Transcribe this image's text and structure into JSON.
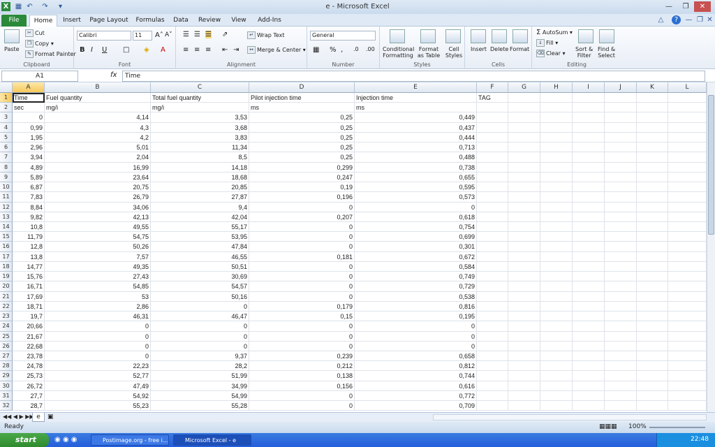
{
  "window": {
    "title": "e - Microsoft Excel"
  },
  "tabs": [
    "File",
    "Home",
    "Insert",
    "Page Layout",
    "Formulas",
    "Data",
    "Review",
    "View",
    "Add-Ins"
  ],
  "ribbon": {
    "clipboard": {
      "label": "Clipboard",
      "paste": "Paste",
      "cut": "Cut",
      "copy": "Copy",
      "format_painter": "Format Painter"
    },
    "font": {
      "label": "Font",
      "name": "Calibri",
      "size": "11"
    },
    "alignment": {
      "label": "Alignment",
      "wrap": "Wrap Text",
      "merge": "Merge & Center"
    },
    "number": {
      "label": "Number",
      "format": "General"
    },
    "styles": {
      "label": "Styles",
      "conditional": "Conditional",
      "conditional2": "Formatting",
      "format_table": "Format",
      "format_table2": "as Table",
      "cell_styles": "Cell",
      "cell_styles2": "Styles"
    },
    "cells": {
      "label": "Cells",
      "insert": "Insert",
      "delete": "Delete",
      "format": "Format"
    },
    "editing": {
      "label": "Editing",
      "autosum": "AutoSum",
      "fill": "Fill",
      "clear": "Clear",
      "sort": "Sort &",
      "sort2": "Filter",
      "find": "Find &",
      "find2": "Select"
    }
  },
  "formula": {
    "namebox": "A1",
    "fx": "fx",
    "content": "Time"
  },
  "columns": [
    "A",
    "B",
    "C",
    "D",
    "E",
    "F",
    "G",
    "H",
    "I",
    "J",
    "K",
    "L"
  ],
  "rows": [
    [
      "Time",
      "Fuel quantity",
      "Total fuel quantity",
      "Pilot injection time",
      "Injection time",
      "TAG"
    ],
    [
      "sec",
      "mg/i",
      "mg/i",
      "ms",
      "ms",
      ""
    ],
    [
      "0",
      "4,14",
      "3,53",
      "0,25",
      "0,449",
      ""
    ],
    [
      "0,99",
      "4,3",
      "3,68",
      "0,25",
      "0,437",
      ""
    ],
    [
      "1,95",
      "4,2",
      "3,83",
      "0,25",
      "0,444",
      ""
    ],
    [
      "2,96",
      "5,01",
      "11,34",
      "0,25",
      "0,713",
      ""
    ],
    [
      "3,94",
      "2,04",
      "8,5",
      "0,25",
      "0,488",
      ""
    ],
    [
      "4,89",
      "16,99",
      "14,18",
      "0,299",
      "0,738",
      ""
    ],
    [
      "5,89",
      "23,64",
      "18,68",
      "0,247",
      "0,655",
      ""
    ],
    [
      "6,87",
      "20,75",
      "20,85",
      "0,19",
      "0,595",
      ""
    ],
    [
      "7,83",
      "26,79",
      "27,87",
      "0,196",
      "0,573",
      ""
    ],
    [
      "8,84",
      "34,06",
      "9,4",
      "0",
      "0",
      ""
    ],
    [
      "9,82",
      "42,13",
      "42,04",
      "0,207",
      "0,618",
      ""
    ],
    [
      "10,8",
      "49,55",
      "55,17",
      "0",
      "0,754",
      ""
    ],
    [
      "11,79",
      "54,75",
      "53,95",
      "0",
      "0,699",
      ""
    ],
    [
      "12,8",
      "50,26",
      "47,84",
      "0",
      "0,301",
      ""
    ],
    [
      "13,8",
      "7,57",
      "46,55",
      "0,181",
      "0,672",
      ""
    ],
    [
      "14,77",
      "49,35",
      "50,51",
      "0",
      "0,584",
      ""
    ],
    [
      "15,76",
      "27,43",
      "30,69",
      "0",
      "0,749",
      ""
    ],
    [
      "16,71",
      "54,85",
      "54,57",
      "0",
      "0,729",
      ""
    ],
    [
      "17,69",
      "53",
      "50,16",
      "0",
      "0,538",
      ""
    ],
    [
      "18,71",
      "2,86",
      "0",
      "0,179",
      "0,816",
      ""
    ],
    [
      "19,7",
      "46,31",
      "46,47",
      "0,15",
      "0,195",
      ""
    ],
    [
      "20,66",
      "0",
      "0",
      "0",
      "0",
      ""
    ],
    [
      "21,67",
      "0",
      "0",
      "0",
      "0",
      ""
    ],
    [
      "22,68",
      "0",
      "0",
      "0",
      "0",
      ""
    ],
    [
      "23,78",
      "0",
      "9,37",
      "0,239",
      "0,658",
      ""
    ],
    [
      "24,78",
      "22,23",
      "28,2",
      "0,212",
      "0,812",
      ""
    ],
    [
      "25,73",
      "52,77",
      "51,99",
      "0,138",
      "0,744",
      ""
    ],
    [
      "26,72",
      "47,49",
      "34,99",
      "0,156",
      "0,616",
      ""
    ],
    [
      "27,7",
      "54,92",
      "54,99",
      "0",
      "0,772",
      ""
    ],
    [
      "28,7",
      "55,23",
      "55,28",
      "0",
      "0,709",
      ""
    ]
  ],
  "sheet": {
    "tab": "e"
  },
  "status": {
    "ready": "Ready",
    "zoom": "100%"
  },
  "taskbar": {
    "start": "start",
    "task1": "Postimage.org - free i...",
    "task2": "Microsoft Excel - e",
    "clock": "22:48"
  }
}
